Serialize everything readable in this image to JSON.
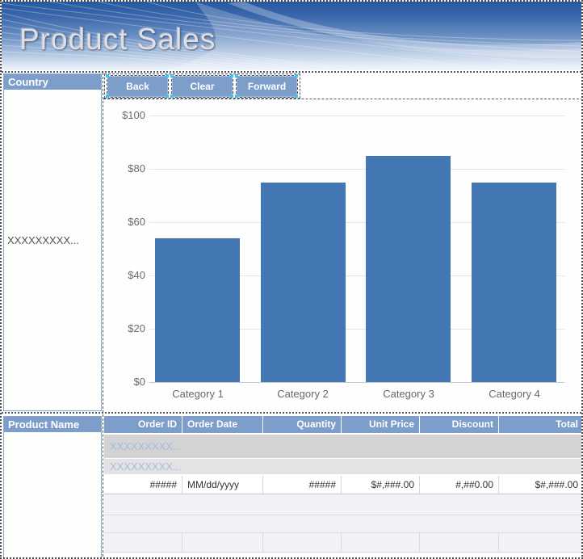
{
  "banner": {
    "title": "Product Sales"
  },
  "country_panel": {
    "header": "Country",
    "placeholder_item": "XXXXXXXXX..."
  },
  "toolbar": {
    "buttons": [
      {
        "label": "Back"
      },
      {
        "label": "Clear"
      },
      {
        "label": "Forward"
      }
    ]
  },
  "chart_data": {
    "type": "bar",
    "categories": [
      "Category 1",
      "Category 2",
      "Category 3",
      "Category 4"
    ],
    "values": [
      54,
      75,
      85,
      75
    ],
    "y_ticks": [
      "$100",
      "$80",
      "$60",
      "$40",
      "$20",
      "$0"
    ],
    "ylim": [
      0,
      100
    ],
    "grid": true,
    "legend": "none",
    "title": "",
    "xlabel": "",
    "ylabel": "",
    "bar_color": "#4478b4"
  },
  "product_panel": {
    "header": "Product Name"
  },
  "table": {
    "columns": [
      {
        "label": "Order ID",
        "align": "r"
      },
      {
        "label": "Order Date",
        "align": "l"
      },
      {
        "label": "Quantity",
        "align": "r"
      },
      {
        "label": "Unit Price",
        "align": "r"
      },
      {
        "label": "Discount",
        "align": "r"
      },
      {
        "label": "Total",
        "align": "r"
      }
    ],
    "group_row_1": "XXXXXXXXX...",
    "group_row_2": "XXXXXXXXX...",
    "detail_row": [
      "#####",
      "MM/dd/yyyy",
      "#####",
      "$#,###.00",
      "#,##0.00",
      "$#,###.00"
    ]
  },
  "colors": {
    "accent_header": "#7d9ecb",
    "bar": "#4478b4",
    "group_text": "#a6bcdc",
    "banner_top": "#27589f",
    "banner_bottom": "#eef3fa"
  }
}
